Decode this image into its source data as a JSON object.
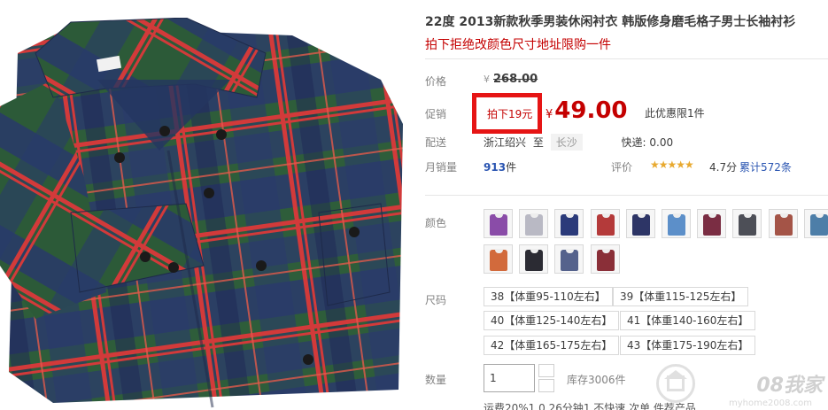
{
  "product": {
    "title": "22度 2013新款秋季男装休闲衬衣 韩版修身磨毛格子男士长袖衬衫",
    "subtitle": "拍下拒绝改颜色尺寸地址限购一件"
  },
  "price": {
    "label": "价格",
    "currency": "¥",
    "original": "268.00"
  },
  "promo": {
    "label": "促销",
    "tag": "拍下19元",
    "currency": "¥",
    "price": "49.00",
    "limit": "此优惠限1件"
  },
  "shipping": {
    "label": "配送",
    "from": "浙江绍兴",
    "to_word": "至",
    "to_city": "长沙",
    "express": "快递: 0.00"
  },
  "sales": {
    "label": "月销量",
    "count": "913",
    "unit": "件",
    "review_label": "评价",
    "stars": "★★★★★",
    "score": "4.7分",
    "cumulative": "累计572条"
  },
  "colors": {
    "label": "颜色",
    "swatches": [
      {
        "name": "purple",
        "color": "#8a4ca8"
      },
      {
        "name": "light-grey",
        "color": "#b9b9c4"
      },
      {
        "name": "navy-check",
        "color": "#2b3a7a"
      },
      {
        "name": "red-check",
        "color": "#b43a3a"
      },
      {
        "name": "navy-red",
        "color": "#2d3566"
      },
      {
        "name": "sky-blue",
        "color": "#5c8fc9"
      },
      {
        "name": "wine",
        "color": "#7a2d43"
      },
      {
        "name": "dark-grey",
        "color": "#4d4f57"
      },
      {
        "name": "rust",
        "color": "#a45447"
      },
      {
        "name": "teal-blue",
        "color": "#4d7ea8"
      },
      {
        "name": "orange-check",
        "color": "#d26a3c"
      },
      {
        "name": "black-check",
        "color": "#2b2b33"
      },
      {
        "name": "slate-blue",
        "color": "#55628c"
      },
      {
        "name": "maroon",
        "color": "#8a2f38"
      }
    ]
  },
  "sizes": {
    "label": "尺码",
    "options": [
      "38【体重95-110左右】",
      "39【体重115-125左右】",
      "40【体重125-140左右】",
      "41【体重140-160左右】",
      "42【体重165-175左右】",
      "43【体重175-190左右】"
    ]
  },
  "quantity": {
    "label": "数量",
    "value": "1",
    "stock": "库存3006件"
  },
  "footer": {
    "partial_text": "运费20%1.0.26分钟1.不快速.次单.件荐产品"
  },
  "watermark": {
    "text": "08我家",
    "url": "myhome2008.com"
  }
}
